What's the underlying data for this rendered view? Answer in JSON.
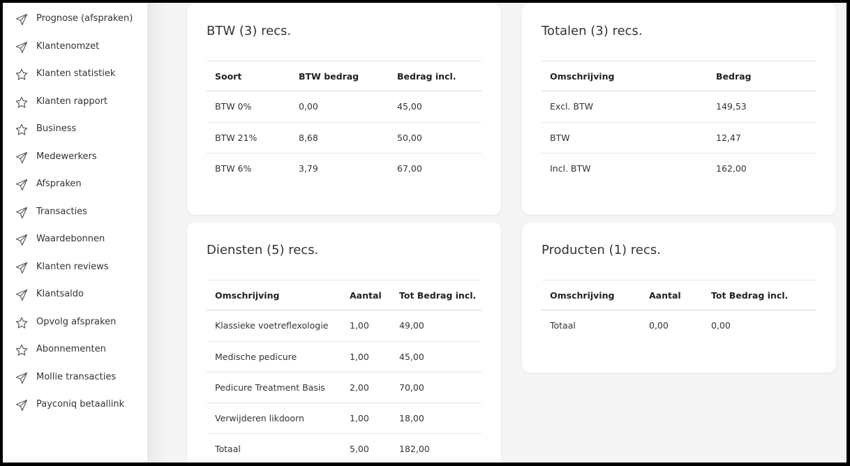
{
  "sidebar": {
    "items": [
      {
        "label": "Prognose (afspraken)",
        "icon": "send-icon"
      },
      {
        "label": "Klantenomzet",
        "icon": "send-icon"
      },
      {
        "label": "Klanten statistiek",
        "icon": "star-icon"
      },
      {
        "label": "Klanten rapport",
        "icon": "star-icon"
      },
      {
        "label": "Business",
        "icon": "star-icon"
      },
      {
        "label": "Medewerkers",
        "icon": "send-icon"
      },
      {
        "label": "Afspraken",
        "icon": "send-icon"
      },
      {
        "label": "Transacties",
        "icon": "send-icon"
      },
      {
        "label": "Waardebonnen",
        "icon": "send-icon"
      },
      {
        "label": "Klanten reviews",
        "icon": "send-icon"
      },
      {
        "label": "Klantsaldo",
        "icon": "send-icon"
      },
      {
        "label": "Opvolg afspraken",
        "icon": "star-icon"
      },
      {
        "label": "Abonnementen",
        "icon": "star-icon"
      },
      {
        "label": "Mollie transacties",
        "icon": "send-icon"
      },
      {
        "label": "Payconiq betaallink",
        "icon": "send-icon"
      }
    ]
  },
  "btw": {
    "title": "BTW (3) recs.",
    "headers": [
      "Soort",
      "BTW bedrag",
      "Bedrag incl."
    ],
    "rows": [
      [
        "BTW 0%",
        "0,00",
        "45,00"
      ],
      [
        "BTW 21%",
        "8,68",
        "50,00"
      ],
      [
        "BTW 6%",
        "3,79",
        "67,00"
      ]
    ]
  },
  "totalen": {
    "title": "Totalen (3) recs.",
    "headers": [
      "Omschrijving",
      "Bedrag"
    ],
    "rows": [
      [
        "Excl. BTW",
        "149,53"
      ],
      [
        "BTW",
        "12,47"
      ],
      [
        "Incl. BTW",
        "162,00"
      ]
    ]
  },
  "diensten": {
    "title": "Diensten (5) recs.",
    "headers": [
      "Omschrijving",
      "Aantal",
      "Tot Bedrag incl."
    ],
    "rows": [
      [
        "Klassieke voetreflexologie",
        "1,00",
        "49,00"
      ],
      [
        "Medische pedicure",
        "1,00",
        "45,00"
      ],
      [
        "Pedicure Treatment Basis",
        "2,00",
        "70,00"
      ],
      [
        "Verwijderen likdoorn",
        "1,00",
        "18,00"
      ],
      [
        "Totaal",
        "5,00",
        "182,00"
      ]
    ]
  },
  "producten": {
    "title": "Producten (1) recs.",
    "headers": [
      "Omschrijving",
      "Aantal",
      "Tot Bedrag incl."
    ],
    "rows": [
      [
        "Totaal",
        "0,00",
        "0,00"
      ]
    ]
  }
}
